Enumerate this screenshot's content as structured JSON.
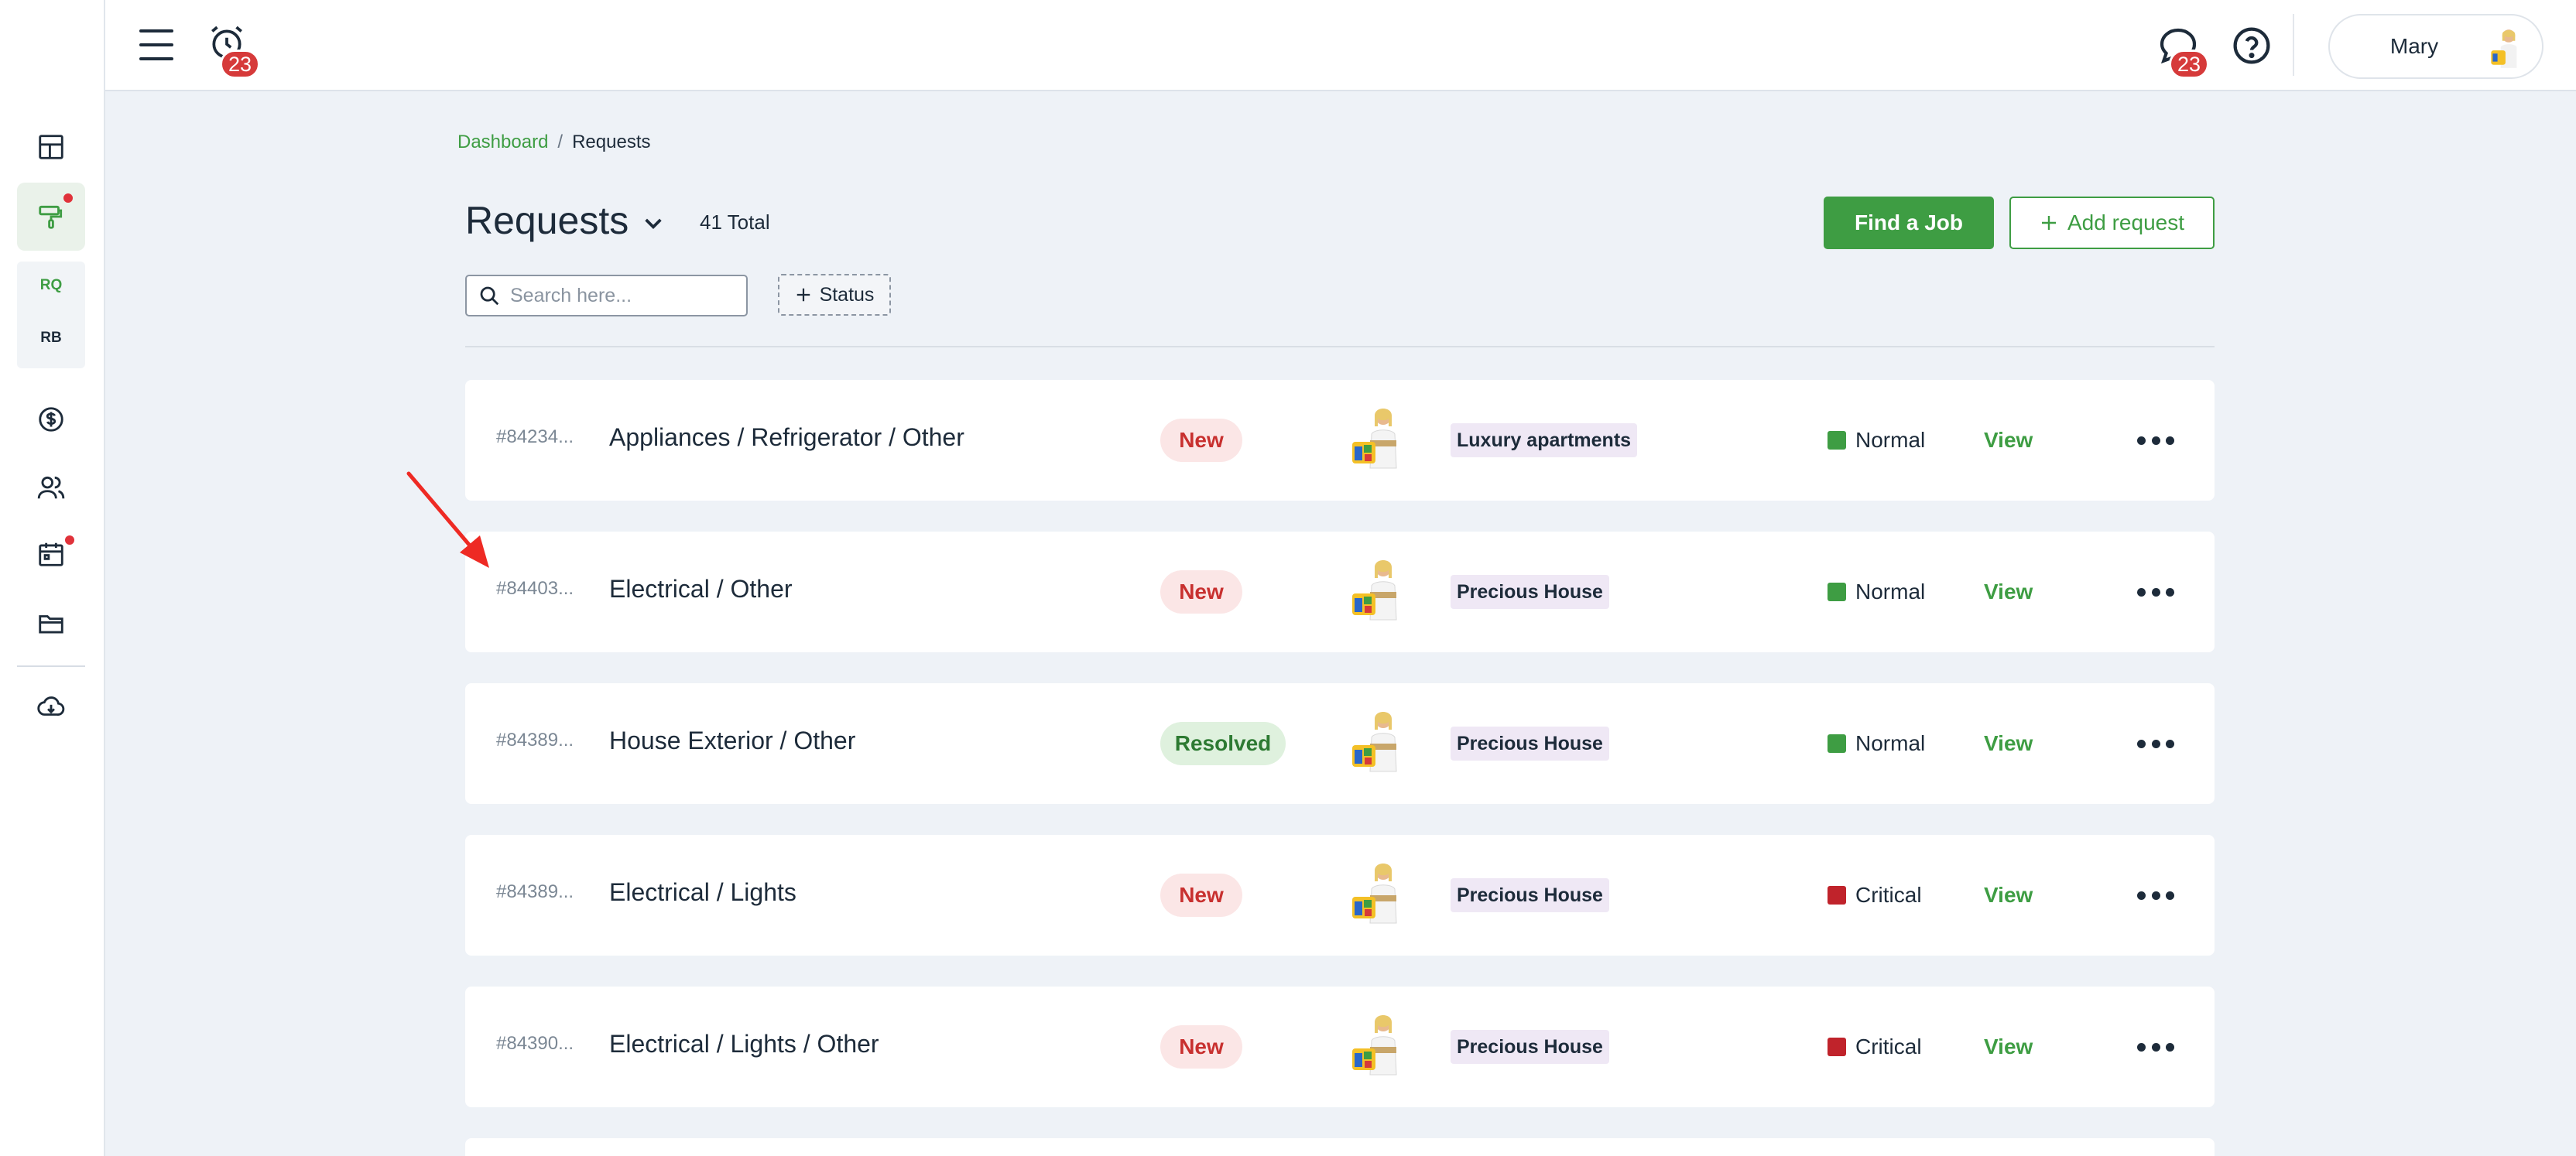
{
  "header": {
    "alerts_count": "23",
    "messages_count": "23",
    "user_name": "Mary"
  },
  "sidebar": {
    "items": [
      {
        "icon": "dashboard-grid-icon"
      },
      {
        "icon": "paint-roller-icon",
        "active": true,
        "dot": true
      },
      {
        "label": "RQ",
        "color": "#3e9d43"
      },
      {
        "label": "RB",
        "color": "#1d2b3a"
      },
      {
        "icon": "dollar-icon"
      },
      {
        "icon": "users-icon"
      },
      {
        "icon": "calendar-icon",
        "dot": true
      },
      {
        "icon": "folder-icon"
      },
      {
        "icon": "cloud-download-icon"
      }
    ]
  },
  "breadcrumb": {
    "home": "Dashboard",
    "separator": "/",
    "current": "Requests"
  },
  "page": {
    "title": "Requests",
    "total": "41 Total",
    "find_job_label": "Find a Job",
    "add_request_label": "Add request",
    "search_placeholder": "Search here...",
    "status_filter_label": "Status"
  },
  "colors": {
    "accent": "#3e9d43",
    "normal": "#3e9d43",
    "critical": "#c0232b",
    "new_badge_bg": "#fbe6e6",
    "resolved_badge_bg": "#dff1de"
  },
  "rows": [
    {
      "id": "#84234...",
      "title": "Appliances / Refrigerator / Other",
      "status": "New",
      "property": "Luxury apartments",
      "priority": "Normal",
      "action": "View"
    },
    {
      "id": "#84403...",
      "title": "Electrical / Other",
      "status": "New",
      "property": "Precious House",
      "priority": "Normal",
      "action": "View"
    },
    {
      "id": "#84389...",
      "title": "House Exterior / Other",
      "status": "Resolved",
      "property": "Precious House",
      "priority": "Normal",
      "action": "View"
    },
    {
      "id": "#84389...",
      "title": "Electrical / Lights",
      "status": "New",
      "property": "Precious House",
      "priority": "Critical",
      "action": "View"
    },
    {
      "id": "#84390...",
      "title": "Electrical / Lights / Other",
      "status": "New",
      "property": "Precious House",
      "priority": "Critical",
      "action": "View"
    }
  ]
}
